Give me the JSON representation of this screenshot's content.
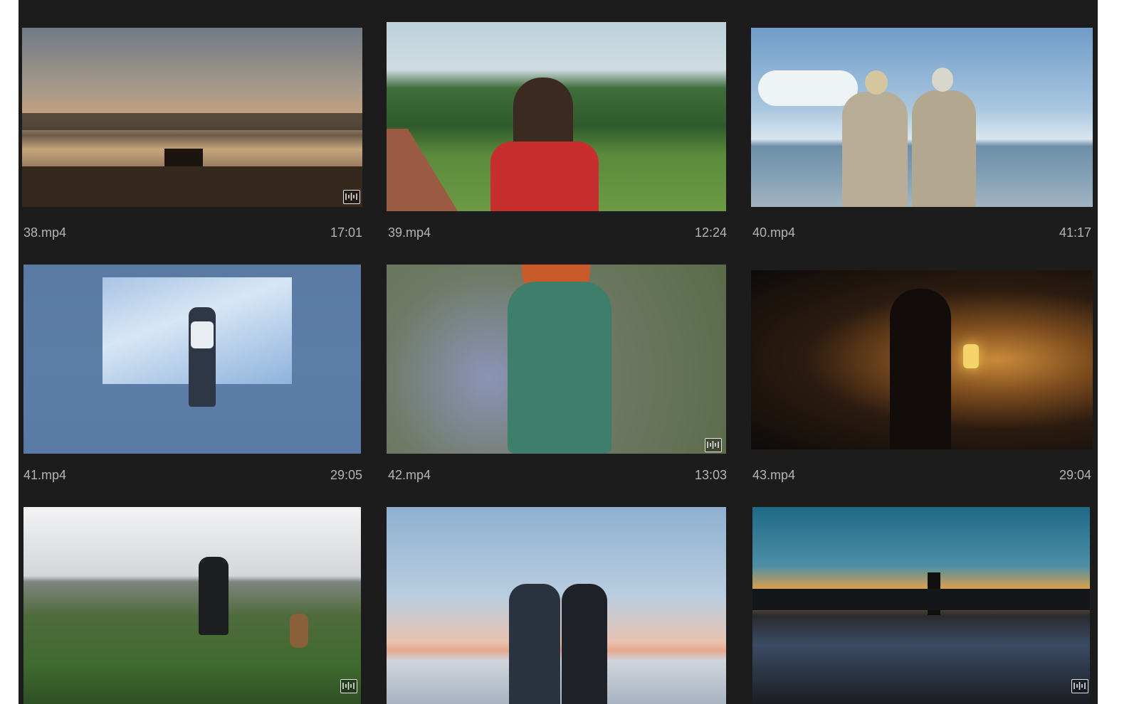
{
  "media_grid": {
    "items": [
      {
        "filename": "38.mp4",
        "duration": "17:01",
        "has_audio_badge": true,
        "scene": "misty lake at sunrise, person on bench",
        "badge_icon": "audio-waveform-icon"
      },
      {
        "filename": "39.mp4",
        "duration": "12:24",
        "has_audio_badge": false,
        "scene": "woman with long hair in red top walking in meadow by forest"
      },
      {
        "filename": "40.mp4",
        "duration": "41:17",
        "has_audio_badge": false,
        "scene": "elderly couple in beige coats looking at sea"
      },
      {
        "filename": "41.mp4",
        "duration": "29:05",
        "has_audio_badge": false,
        "scene": "dancer with raised arms in front of sky projection"
      },
      {
        "filename": "42.mp4",
        "duration": "13:03",
        "has_audio_badge": true,
        "scene": "red-haired woman in green dress walking in flower field",
        "badge_icon": "audio-waveform-icon"
      },
      {
        "filename": "43.mp4",
        "duration": "29:04",
        "has_audio_badge": false,
        "scene": "figure with lantern in dark cave"
      },
      {
        "filename": "",
        "duration": "",
        "has_audio_badge": true,
        "scene": "man and dogs on green hill",
        "badge_icon": "audio-waveform-icon"
      },
      {
        "filename": "",
        "duration": "",
        "has_audio_badge": false,
        "scene": "couple holding hands at sunset by water"
      },
      {
        "filename": "",
        "duration": "",
        "has_audio_badge": true,
        "scene": "temple silhouette at sunset over lake",
        "badge_icon": "audio-waveform-icon"
      }
    ]
  },
  "colors": {
    "panel_background": "#1c1c1c",
    "label_text": "#b3b3b3",
    "badge_border": "#e6e6e6"
  }
}
